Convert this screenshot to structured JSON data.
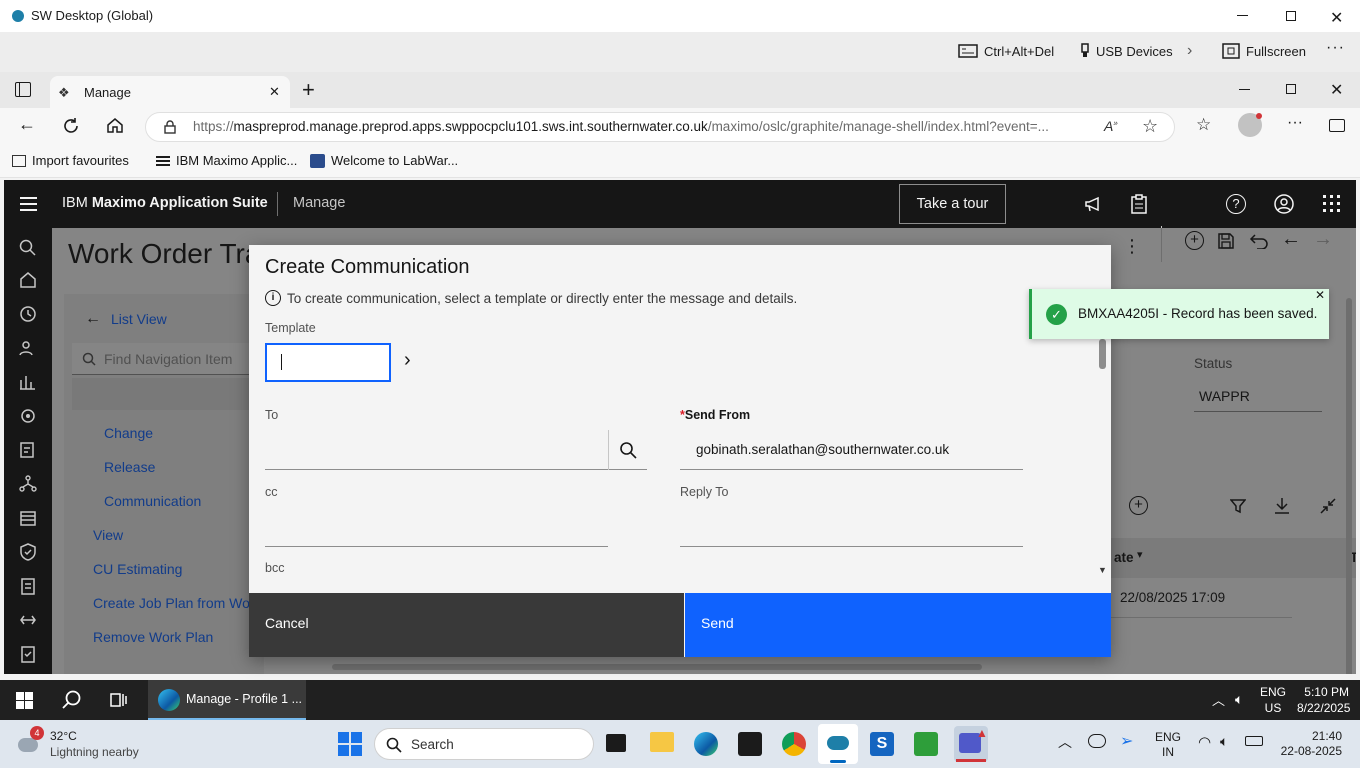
{
  "remote_window": {
    "title": "SW Desktop (Global)",
    "toolbar": {
      "ctrl_alt_del": "Ctrl+Alt+Del",
      "usb_devices": "USB Devices",
      "fullscreen": "Fullscreen"
    }
  },
  "browser": {
    "tab_title": "Manage",
    "url_prefix": "https://",
    "url_host": "maspreprod.manage.preprod.apps.swppocpclu101.sws.int.southernwater.co.uk",
    "url_path": "/maximo/oslc/graphite/manage-shell/index.html?event=...",
    "favourites": [
      {
        "label": "Import favourites"
      },
      {
        "label": "IBM Maximo Applic..."
      },
      {
        "label": "Welcome to LabWar..."
      }
    ]
  },
  "app": {
    "brand_prefix": "IBM ",
    "brand_bold": "Maximo Application Suite",
    "module": "Manage",
    "tour_button": "Take a tour",
    "page_title": "Work Order Tra",
    "list_view": "List View",
    "find_placeholder": "Find Navigation Item",
    "nav_sub_items": [
      "Change",
      "Release",
      "Communication"
    ],
    "nav_items": [
      "View",
      "CU Estimating",
      "Create Job Plan from Work",
      "Remove Work Plan"
    ],
    "status_label": "Status",
    "status_value": "WAPPR",
    "date_header": "ate",
    "date_header_extra": "T",
    "date_value": "22/08/2025 17:09"
  },
  "modal": {
    "title": "Create Communication",
    "info_text": "To create communication, select a template or directly enter the message and details.",
    "template_label": "Template",
    "template_value": "",
    "to_label": "To",
    "send_from_required": "*",
    "send_from_label": "Send From",
    "send_from_value": "gobinath.seralathan@southernwater.co.uk",
    "cc_label": "cc",
    "reply_to_label": "Reply To",
    "bcc_label": "bcc",
    "cancel_label": "Cancel",
    "send_label": "Send"
  },
  "toast": {
    "message": "BMXAA4205I - Record has been saved."
  },
  "inner_taskbar": {
    "app_label": "Manage - Profile 1 ...",
    "lang": "ENG",
    "region": "US",
    "time": "5:10 PM",
    "date": "8/22/2025"
  },
  "outer_taskbar": {
    "weather_badge": "4",
    "temperature": "32°C",
    "weather_text": "Lightning nearby",
    "search_placeholder": "Search",
    "lang": "ENG",
    "region": "IN",
    "time": "21:40",
    "date": "22-08-2025"
  },
  "colors": {
    "header_bg": "#161616",
    "primary_blue": "#0f62fe",
    "link_blue": "#0f62fe",
    "success_green": "#24a148",
    "toast_bg": "#defbe6",
    "required_red": "#da1e28"
  }
}
